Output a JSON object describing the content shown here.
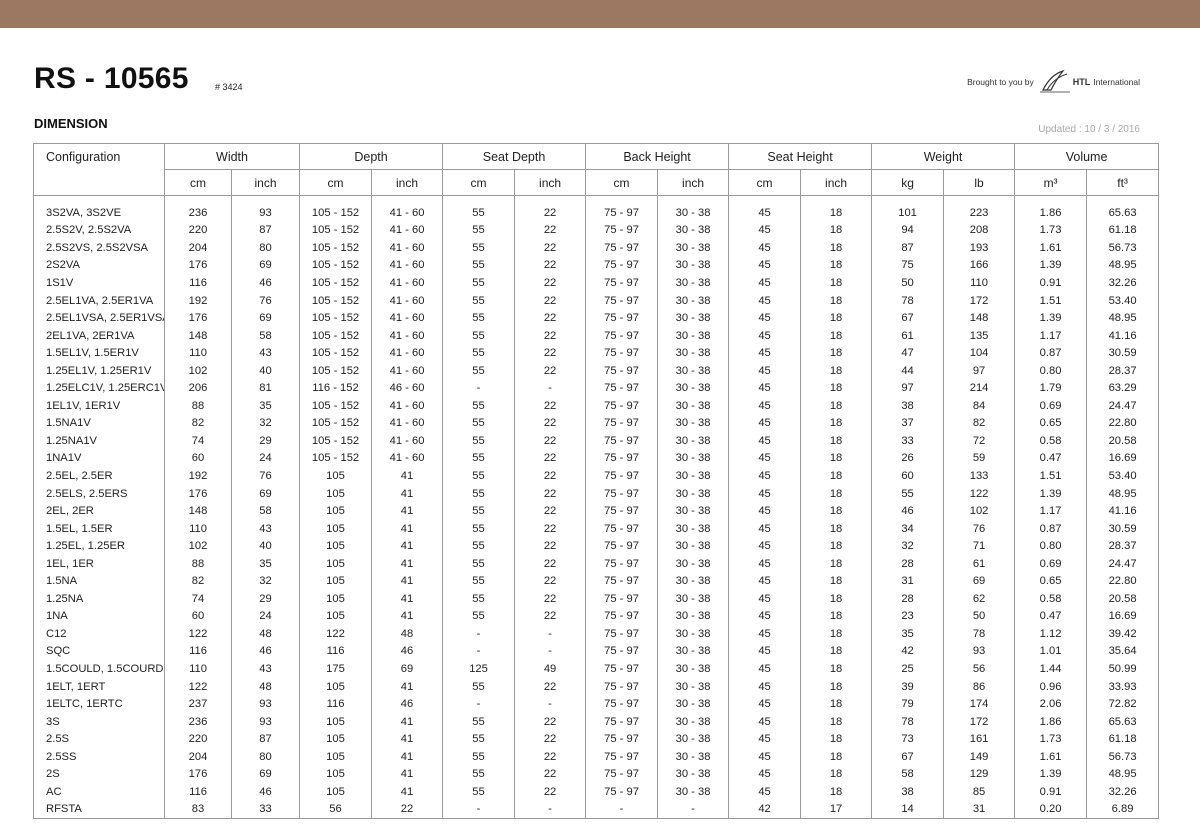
{
  "header": {
    "title": "RS - 10565",
    "code": "# 3424",
    "brought_by": "Brought to you by",
    "brand_name": "HTL",
    "brand_suffix": "International",
    "band_color": "#9c7862"
  },
  "section_title": "DIMENSION",
  "updated": "Updated : 10 / 3 / 2016",
  "table": {
    "config_header": "Configuration",
    "groups": [
      "Width",
      "Depth",
      "Seat Depth",
      "Back Height",
      "Seat Height",
      "Weight",
      "Volume"
    ],
    "units": [
      "cm",
      "inch",
      "cm",
      "inch",
      "cm",
      "inch",
      "cm",
      "inch",
      "cm",
      "inch",
      "kg",
      "lb",
      "m³",
      "ft³"
    ],
    "rows": [
      [
        "3S2VA, 3S2VE",
        "236",
        "93",
        "105 - 152",
        "41 - 60",
        "55",
        "22",
        "75 - 97",
        "30 - 38",
        "45",
        "18",
        "101",
        "223",
        "1.86",
        "65.63"
      ],
      [
        "2.5S2V, 2.5S2VA",
        "220",
        "87",
        "105 - 152",
        "41 - 60",
        "55",
        "22",
        "75 - 97",
        "30 - 38",
        "45",
        "18",
        "94",
        "208",
        "1.73",
        "61.18"
      ],
      [
        "2.5S2VS, 2.5S2VSA",
        "204",
        "80",
        "105 - 152",
        "41 - 60",
        "55",
        "22",
        "75 - 97",
        "30 - 38",
        "45",
        "18",
        "87",
        "193",
        "1.61",
        "56.73"
      ],
      [
        "2S2VA",
        "176",
        "69",
        "105 - 152",
        "41 - 60",
        "55",
        "22",
        "75 - 97",
        "30 - 38",
        "45",
        "18",
        "75",
        "166",
        "1.39",
        "48.95"
      ],
      [
        "1S1V",
        "116",
        "46",
        "105 - 152",
        "41 - 60",
        "55",
        "22",
        "75 - 97",
        "30 - 38",
        "45",
        "18",
        "50",
        "110",
        "0.91",
        "32.26"
      ],
      [
        "2.5EL1VA, 2.5ER1VA",
        "192",
        "76",
        "105 - 152",
        "41 - 60",
        "55",
        "22",
        "75 - 97",
        "30 - 38",
        "45",
        "18",
        "78",
        "172",
        "1.51",
        "53.40"
      ],
      [
        "2.5EL1VSA, 2.5ER1VSA",
        "176",
        "69",
        "105 - 152",
        "41 - 60",
        "55",
        "22",
        "75 - 97",
        "30 - 38",
        "45",
        "18",
        "67",
        "148",
        "1.39",
        "48.95"
      ],
      [
        "2EL1VA, 2ER1VA",
        "148",
        "58",
        "105 - 152",
        "41 - 60",
        "55",
        "22",
        "75 - 97",
        "30 - 38",
        "45",
        "18",
        "61",
        "135",
        "1.17",
        "41.16"
      ],
      [
        "1.5EL1V, 1.5ER1V",
        "110",
        "43",
        "105 - 152",
        "41 - 60",
        "55",
        "22",
        "75 - 97",
        "30 - 38",
        "45",
        "18",
        "47",
        "104",
        "0.87",
        "30.59"
      ],
      [
        "1.25EL1V, 1.25ER1V",
        "102",
        "40",
        "105 - 152",
        "41 - 60",
        "55",
        "22",
        "75 - 97",
        "30 - 38",
        "45",
        "18",
        "44",
        "97",
        "0.80",
        "28.37"
      ],
      [
        "1.25ELC1V, 1.25ERC1V",
        "206",
        "81",
        "116 - 152",
        "46 - 60",
        "-",
        "-",
        "75 - 97",
        "30 - 38",
        "45",
        "18",
        "97",
        "214",
        "1.79",
        "63.29"
      ],
      [
        "1EL1V, 1ER1V",
        "88",
        "35",
        "105 - 152",
        "41 - 60",
        "55",
        "22",
        "75 - 97",
        "30 - 38",
        "45",
        "18",
        "38",
        "84",
        "0.69",
        "24.47"
      ],
      [
        "1.5NA1V",
        "82",
        "32",
        "105 - 152",
        "41 - 60",
        "55",
        "22",
        "75 - 97",
        "30 - 38",
        "45",
        "18",
        "37",
        "82",
        "0.65",
        "22.80"
      ],
      [
        "1.25NA1V",
        "74",
        "29",
        "105 - 152",
        "41 - 60",
        "55",
        "22",
        "75 - 97",
        "30 - 38",
        "45",
        "18",
        "33",
        "72",
        "0.58",
        "20.58"
      ],
      [
        "1NA1V",
        "60",
        "24",
        "105 - 152",
        "41 - 60",
        "55",
        "22",
        "75 - 97",
        "30 - 38",
        "45",
        "18",
        "26",
        "59",
        "0.47",
        "16.69"
      ],
      [
        "2.5EL, 2.5ER",
        "192",
        "76",
        "105",
        "41",
        "55",
        "22",
        "75 - 97",
        "30 - 38",
        "45",
        "18",
        "60",
        "133",
        "1.51",
        "53.40"
      ],
      [
        "2.5ELS, 2.5ERS",
        "176",
        "69",
        "105",
        "41",
        "55",
        "22",
        "75 - 97",
        "30 - 38",
        "45",
        "18",
        "55",
        "122",
        "1.39",
        "48.95"
      ],
      [
        "2EL, 2ER",
        "148",
        "58",
        "105",
        "41",
        "55",
        "22",
        "75 - 97",
        "30 - 38",
        "45",
        "18",
        "46",
        "102",
        "1.17",
        "41.16"
      ],
      [
        "1.5EL, 1.5ER",
        "110",
        "43",
        "105",
        "41",
        "55",
        "22",
        "75 - 97",
        "30 - 38",
        "45",
        "18",
        "34",
        "76",
        "0.87",
        "30.59"
      ],
      [
        "1.25EL, 1.25ER",
        "102",
        "40",
        "105",
        "41",
        "55",
        "22",
        "75 - 97",
        "30 - 38",
        "45",
        "18",
        "32",
        "71",
        "0.80",
        "28.37"
      ],
      [
        "1EL, 1ER",
        "88",
        "35",
        "105",
        "41",
        "55",
        "22",
        "75 - 97",
        "30 - 38",
        "45",
        "18",
        "28",
        "61",
        "0.69",
        "24.47"
      ],
      [
        "1.5NA",
        "82",
        "32",
        "105",
        "41",
        "55",
        "22",
        "75 - 97",
        "30 - 38",
        "45",
        "18",
        "31",
        "69",
        "0.65",
        "22.80"
      ],
      [
        "1.25NA",
        "74",
        "29",
        "105",
        "41",
        "55",
        "22",
        "75 - 97",
        "30 - 38",
        "45",
        "18",
        "28",
        "62",
        "0.58",
        "20.58"
      ],
      [
        "1NA",
        "60",
        "24",
        "105",
        "41",
        "55",
        "22",
        "75 - 97",
        "30 - 38",
        "45",
        "18",
        "23",
        "50",
        "0.47",
        "16.69"
      ],
      [
        "C12",
        "122",
        "48",
        "122",
        "48",
        "-",
        "-",
        "75 - 97",
        "30 - 38",
        "45",
        "18",
        "35",
        "78",
        "1.12",
        "39.42"
      ],
      [
        "SQC",
        "116",
        "46",
        "116",
        "46",
        "-",
        "-",
        "75 - 97",
        "30 - 38",
        "45",
        "18",
        "42",
        "93",
        "1.01",
        "35.64"
      ],
      [
        "1.5COULD, 1.5COURD",
        "110",
        "43",
        "175",
        "69",
        "125",
        "49",
        "75 - 97",
        "30 - 38",
        "45",
        "18",
        "25",
        "56",
        "1.44",
        "50.99"
      ],
      [
        "1ELT, 1ERT",
        "122",
        "48",
        "105",
        "41",
        "55",
        "22",
        "75 - 97",
        "30 - 38",
        "45",
        "18",
        "39",
        "86",
        "0.96",
        "33.93"
      ],
      [
        "1ELTC, 1ERTC",
        "237",
        "93",
        "116",
        "46",
        "-",
        "-",
        "75 - 97",
        "30 - 38",
        "45",
        "18",
        "79",
        "174",
        "2.06",
        "72.82"
      ],
      [
        "3S",
        "236",
        "93",
        "105",
        "41",
        "55",
        "22",
        "75 - 97",
        "30 - 38",
        "45",
        "18",
        "78",
        "172",
        "1.86",
        "65.63"
      ],
      [
        "2.5S",
        "220",
        "87",
        "105",
        "41",
        "55",
        "22",
        "75 - 97",
        "30 - 38",
        "45",
        "18",
        "73",
        "161",
        "1.73",
        "61.18"
      ],
      [
        "2.5SS",
        "204",
        "80",
        "105",
        "41",
        "55",
        "22",
        "75 - 97",
        "30 - 38",
        "45",
        "18",
        "67",
        "149",
        "1.61",
        "56.73"
      ],
      [
        "2S",
        "176",
        "69",
        "105",
        "41",
        "55",
        "22",
        "75 - 97",
        "30 - 38",
        "45",
        "18",
        "58",
        "129",
        "1.39",
        "48.95"
      ],
      [
        "AC",
        "116",
        "46",
        "105",
        "41",
        "55",
        "22",
        "75 - 97",
        "30 - 38",
        "45",
        "18",
        "38",
        "85",
        "0.91",
        "32.26"
      ],
      [
        "RFSTA",
        "83",
        "33",
        "56",
        "22",
        "-",
        "-",
        "-",
        "-",
        "42",
        "17",
        "14",
        "31",
        "0.20",
        "6.89"
      ]
    ]
  }
}
